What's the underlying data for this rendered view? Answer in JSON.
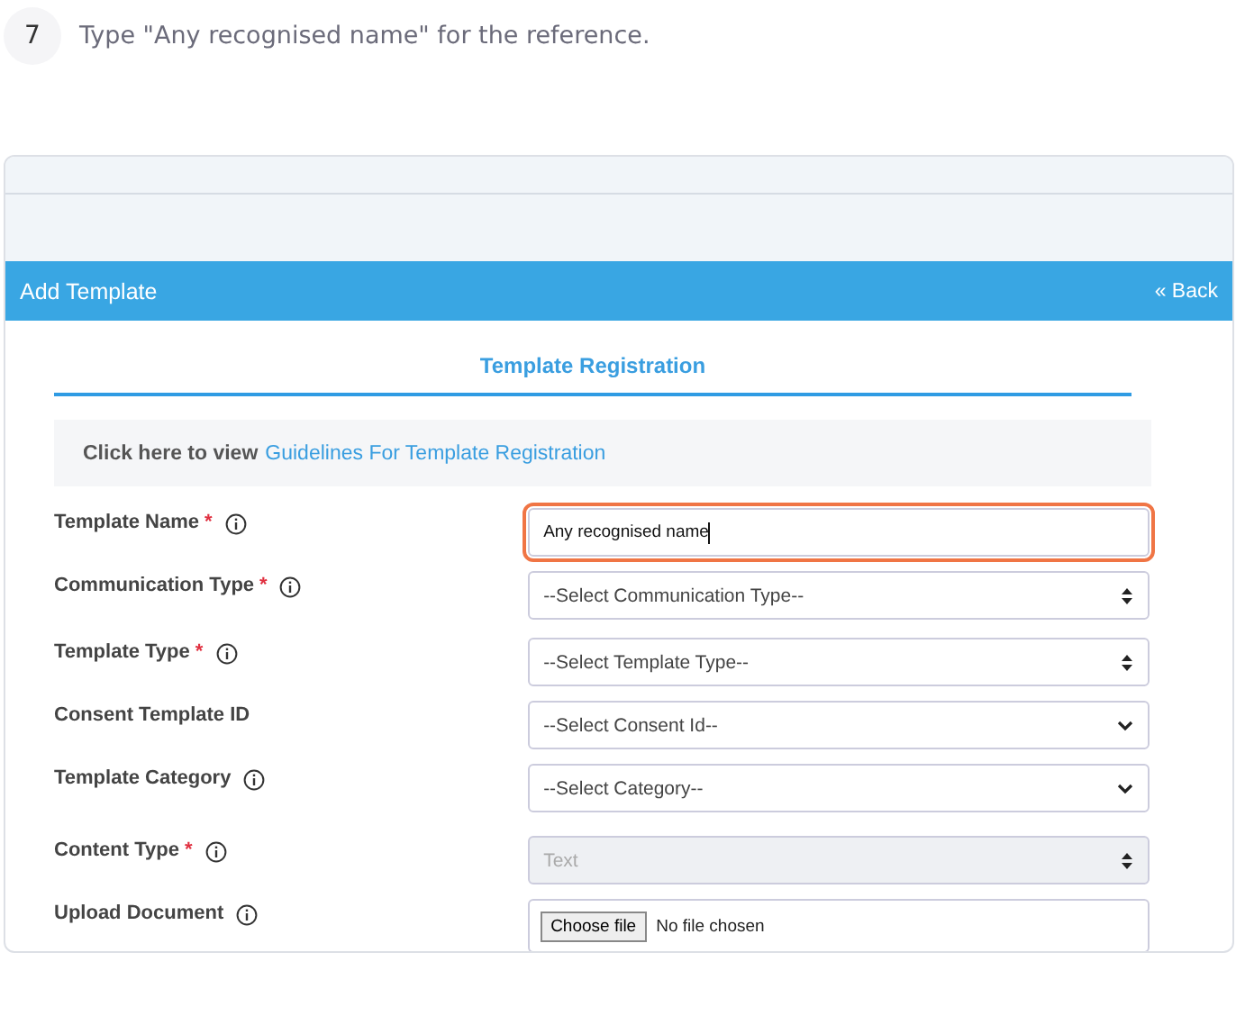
{
  "step": {
    "number": "7",
    "instruction": "Type \"Any recognised name\" for the reference."
  },
  "header": {
    "title": "Add Template",
    "back": "« Back"
  },
  "tab": {
    "label": "Template Registration",
    "selected": true
  },
  "guidelines": {
    "prefix": "Click here to view",
    "link": "Guidelines For Template Registration"
  },
  "fields": [
    {
      "label": "Template Name",
      "asterisk": "*",
      "info": true,
      "kind": "text",
      "value": "Any recognised name",
      "highlighted": true,
      "disabled": false
    },
    {
      "label": "Communication Type",
      "asterisk": "*",
      "info": true,
      "kind": "select",
      "value": "--Select Communication Type--",
      "highlighted": false,
      "disabled": false
    },
    {
      "label": "Template Type",
      "asterisk": "*",
      "info": true,
      "kind": "select",
      "value": "--Select Template Type--",
      "highlighted": false,
      "disabled": false
    },
    {
      "label": "Consent Template ID",
      "info": false,
      "kind": "dropdown",
      "value": "--Select Consent Id--",
      "highlighted": false,
      "disabled": false
    },
    {
      "label": "Template Category",
      "info": true,
      "kind": "dropdown",
      "value": "--Select Category--",
      "highlighted": false,
      "disabled": false
    },
    {
      "label": "Content Type",
      "asterisk": "*",
      "info": true,
      "kind": "select",
      "value": "Text",
      "highlighted": false,
      "disabled": true
    },
    {
      "label": "Upload Document",
      "info": true,
      "kind": "file",
      "button": "Choose file",
      "value": "No file chosen",
      "highlighted": false,
      "disabled": false
    }
  ]
}
